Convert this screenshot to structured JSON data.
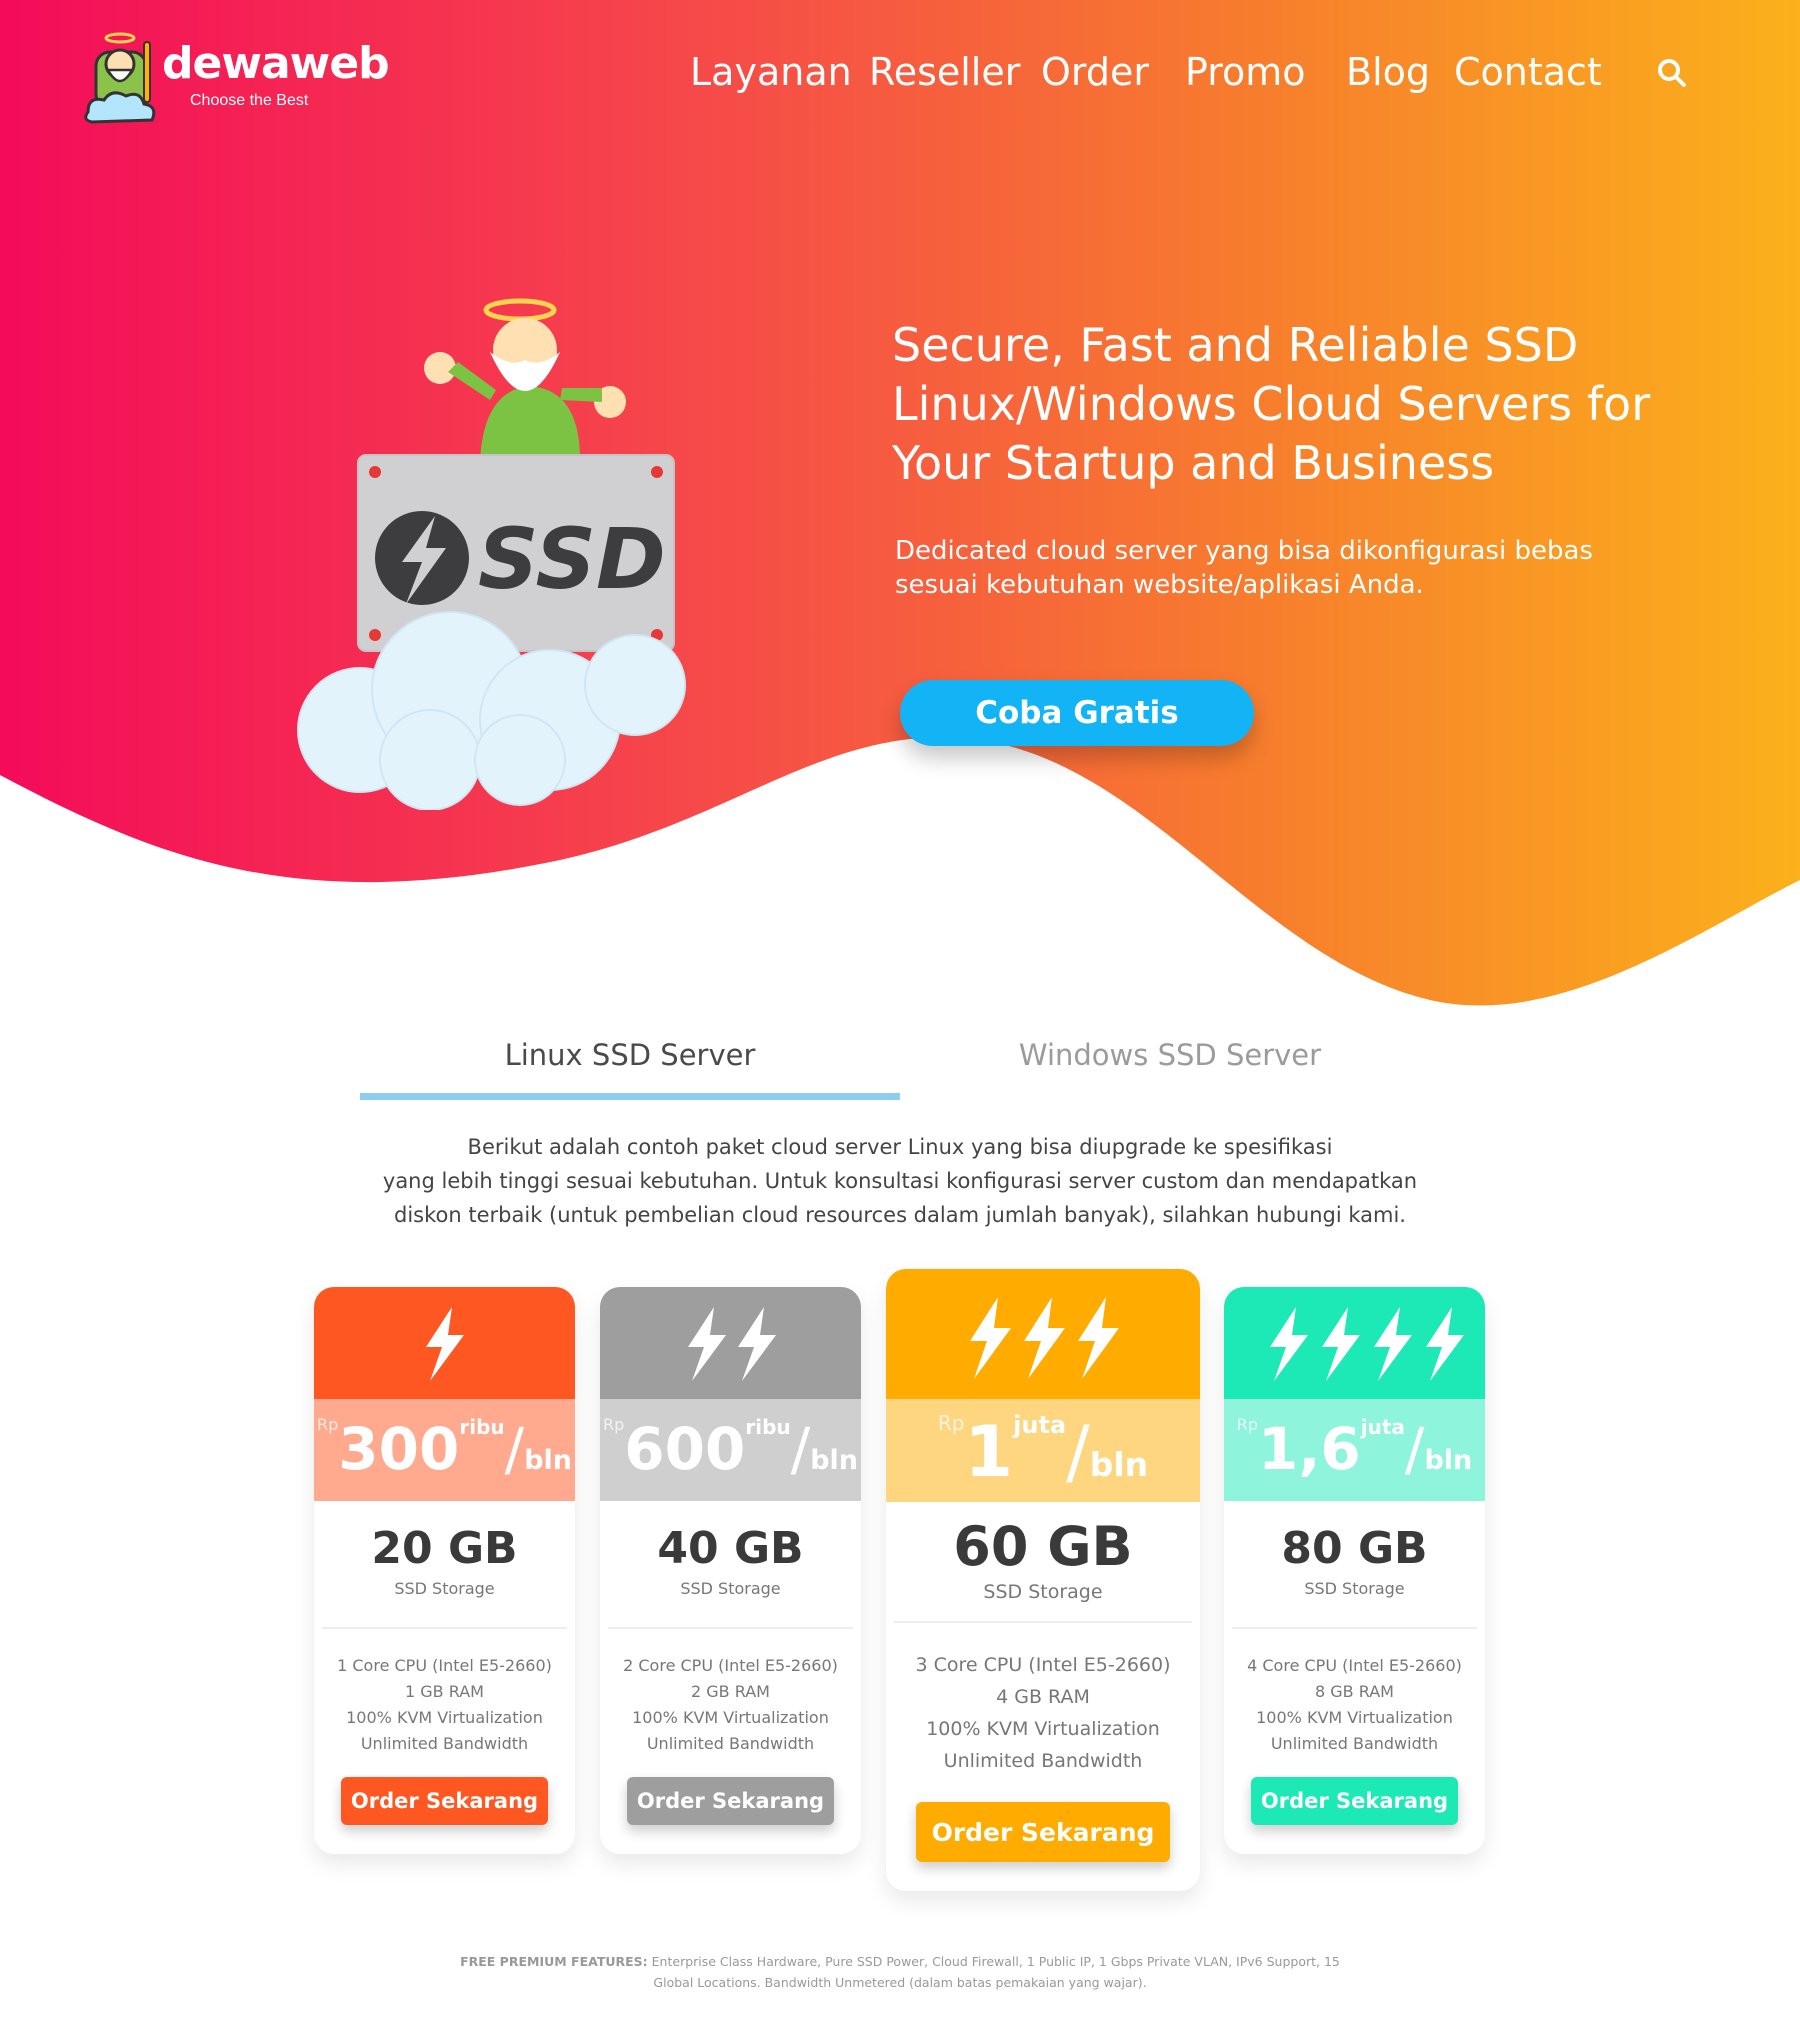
{
  "brand": {
    "name": "dewaweb",
    "tagline": "Choose the Best"
  },
  "nav": {
    "items": [
      "Layanan",
      "Reseller",
      "Order",
      "Promo",
      "Blog",
      "Contact"
    ]
  },
  "hero": {
    "title": "Secure, Fast and Reliable SSD Linux/Windows Cloud Servers for Your Startup and Business",
    "subtitle": "Dedicated cloud server yang bisa dikonfigurasi bebas sesuai kebutuhan website/aplikasi Anda.",
    "cta": "Coba Gratis",
    "badge": "SSD"
  },
  "tabs": [
    "Linux SSD Server",
    "Windows SSD Server"
  ],
  "intro": [
    "Berikut adalah contoh paket cloud server Linux yang bisa diupgrade ke spesifikasi",
    "yang lebih tinggi sesuai kebutuhan. Untuk konsultasi konfigurasi server custom dan mendapatkan",
    "diskon terbaik (untuk pembelian cloud resources dalam jumlah banyak), silahkan hubungi kami."
  ],
  "plans": [
    {
      "bolts": 1,
      "currency": "Rp",
      "amount": "300",
      "unit": "ribu",
      "per": "bln",
      "storage": "20 GB",
      "storage_label": "SSD Storage",
      "features": [
        "1 Core CPU (Intel E5-2660)",
        "1 GB RAM",
        "100% KVM Virtualization",
        "Unlimited Bandwidth"
      ],
      "button": "Order Sekarang",
      "color": "#fe5722",
      "light": "#ffa98e"
    },
    {
      "bolts": 2,
      "currency": "Rp",
      "amount": "600",
      "unit": "ribu",
      "per": "bln",
      "storage": "40 GB",
      "storage_label": "SSD Storage",
      "features": [
        "2 Core CPU (Intel E5-2660)",
        "2 GB RAM",
        "100% KVM Virtualization",
        "Unlimited Bandwidth"
      ],
      "button": "Order Sekarang",
      "color": "#9e9e9e",
      "light": "#cfcfcf"
    },
    {
      "bolts": 3,
      "currency": "Rp",
      "amount": "1",
      "unit": "juta",
      "per": "bln",
      "storage": "60 GB",
      "storage_label": "SSD Storage",
      "features": [
        "3 Core CPU (Intel E5-2660)",
        "4 GB RAM",
        "100% KVM Virtualization",
        "Unlimited Bandwidth"
      ],
      "button": "Order Sekarang",
      "color": "#ffab00",
      "light": "#ffd680"
    },
    {
      "bolts": 4,
      "currency": "Rp",
      "amount": "1,6",
      "unit": "juta",
      "per": "bln",
      "storage": "80 GB",
      "storage_label": "SSD Storage",
      "features": [
        "4 Core CPU (Intel E5-2660)",
        "8 GB RAM",
        "100% KVM Virtualization",
        "Unlimited Bandwidth"
      ],
      "button": "Order Sekarang",
      "color": "#1de9b6",
      "light": "#8ef4db"
    }
  ],
  "footnote": {
    "label": "FREE PREMIUM FEATURES:",
    "text": "Enterprise Class Hardware, Pure SSD Power, Cloud Firewall, 1 Public IP, 1 Gbps Private VLAN, IPv6 Support, 15 Global Locations. Bandwidth Unmetered (dalam batas pemakaian yang wajar)."
  }
}
